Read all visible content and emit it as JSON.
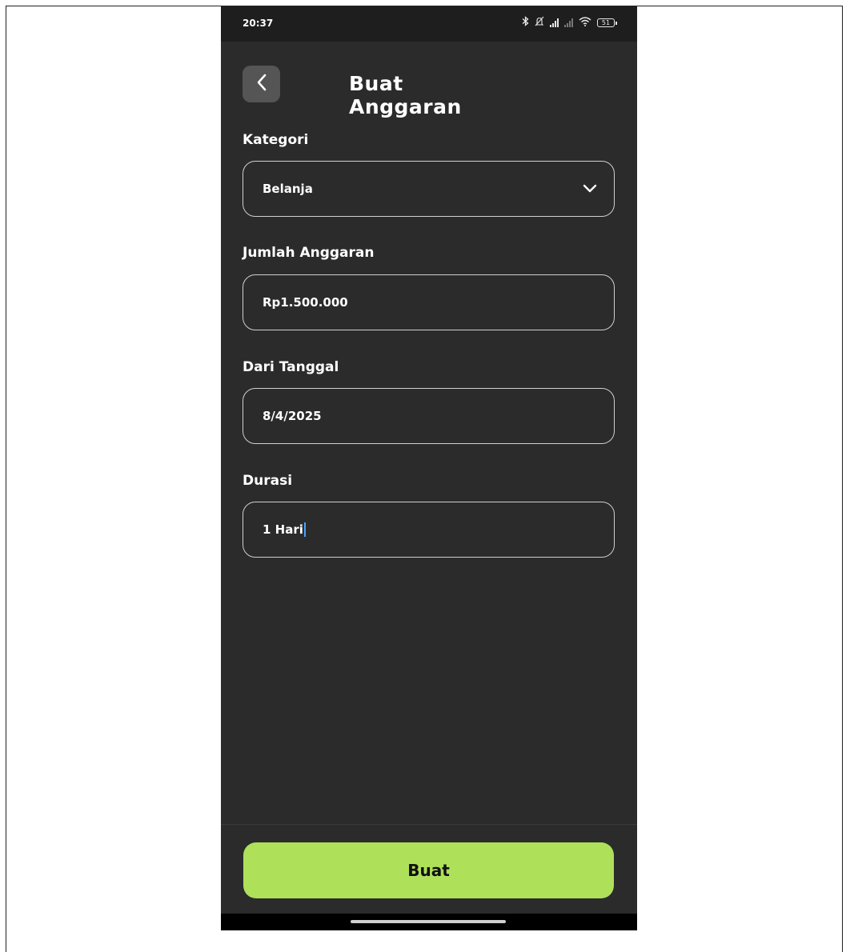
{
  "status_bar": {
    "time": "20:37",
    "battery": "51",
    "icons": [
      "bluetooth-icon",
      "silent-icon",
      "signal-icon",
      "signal-icon",
      "wifi-icon",
      "battery-icon"
    ]
  },
  "header": {
    "title": "Buat Anggaran",
    "back_icon": "chevron-left-icon"
  },
  "form": {
    "category": {
      "label": "Kategori",
      "value": "Belanja",
      "icon": "chevron-down-icon"
    },
    "amount": {
      "label": "Jumlah Anggaran",
      "value": "Rp1.500.000"
    },
    "start_date": {
      "label": "Dari Tanggal",
      "value": "8/4/2025"
    },
    "duration": {
      "label": "Durasi",
      "value": "1 Hari"
    }
  },
  "actions": {
    "submit_label": "Buat"
  },
  "colors": {
    "background": "#2b2b2b",
    "accent": "#aee05a",
    "status_bar": "#1e1e1e"
  }
}
